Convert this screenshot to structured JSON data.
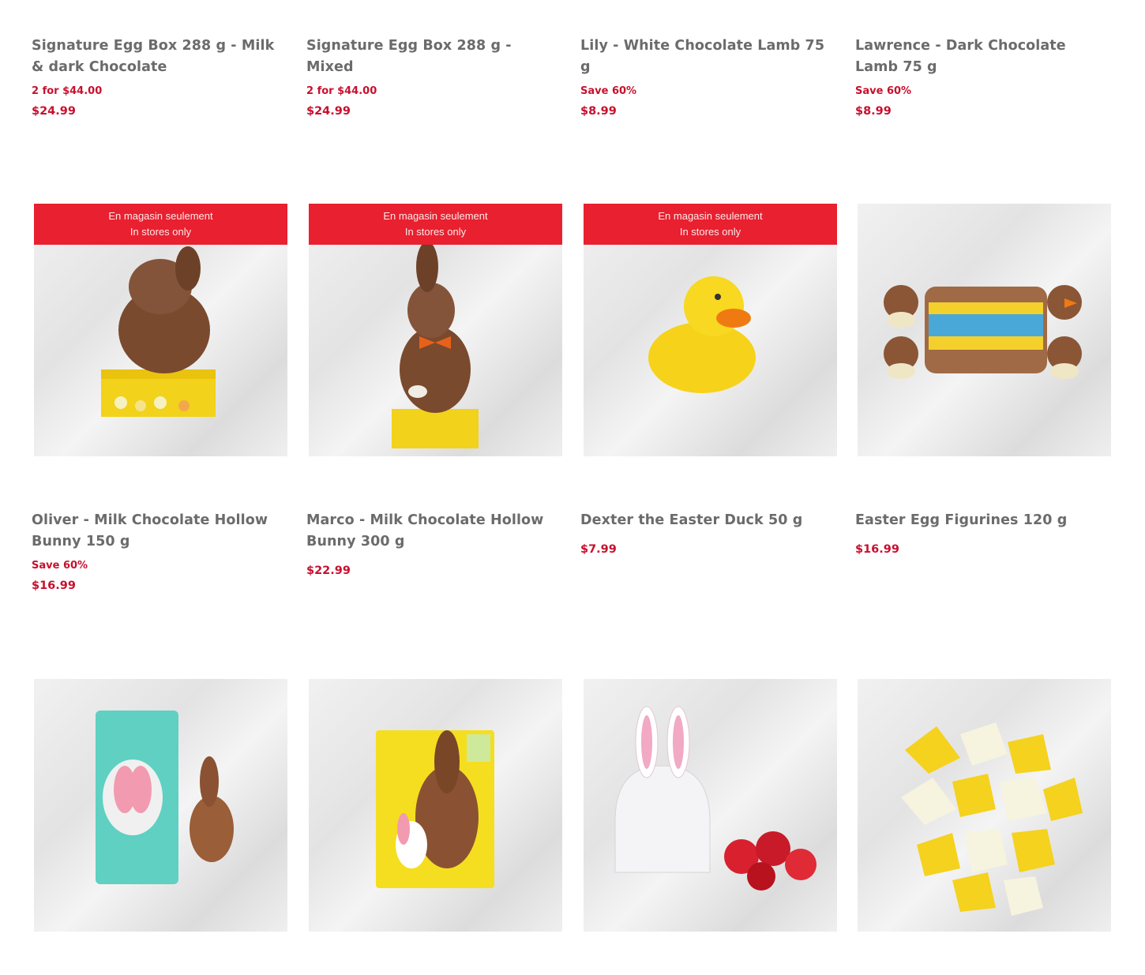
{
  "row1": [
    {
      "title": "Signature Egg Box 288 g - Milk & dark Chocolate",
      "promo": "2 for $44.00",
      "price": "$24.99"
    },
    {
      "title": "Signature Egg Box 288 g - Mixed",
      "promo": "2 for $44.00",
      "price": "$24.99"
    },
    {
      "title": "Lily - White Chocolate Lamb 75 g",
      "promo": "Save 60%",
      "price": "$8.99"
    },
    {
      "title": "Lawrence - Dark Chocolate Lamb 75 g",
      "promo": "Save 60%",
      "price": "$8.99"
    }
  ],
  "row2": [
    {
      "title": "Oliver - Milk Chocolate Hollow Bunny 150 g",
      "promo": "Save 60%",
      "price": "$16.99",
      "banner": [
        "En magasin seulement",
        "In stores only"
      ]
    },
    {
      "title": "Marco - Milk Chocolate Hollow Bunny 300 g",
      "price": "$22.99",
      "banner": [
        "En magasin seulement",
        "In stores only"
      ]
    },
    {
      "title": "Dexter the Easter Duck 50 g",
      "price": "$7.99",
      "banner": [
        "En magasin seulement",
        "In stores only"
      ]
    },
    {
      "title": "Easter Egg Figurines 120 g",
      "price": "$16.99"
    }
  ],
  "colors": {
    "price": "#c8102e",
    "title": "#6b6b6b",
    "banner": "#e8202f"
  }
}
